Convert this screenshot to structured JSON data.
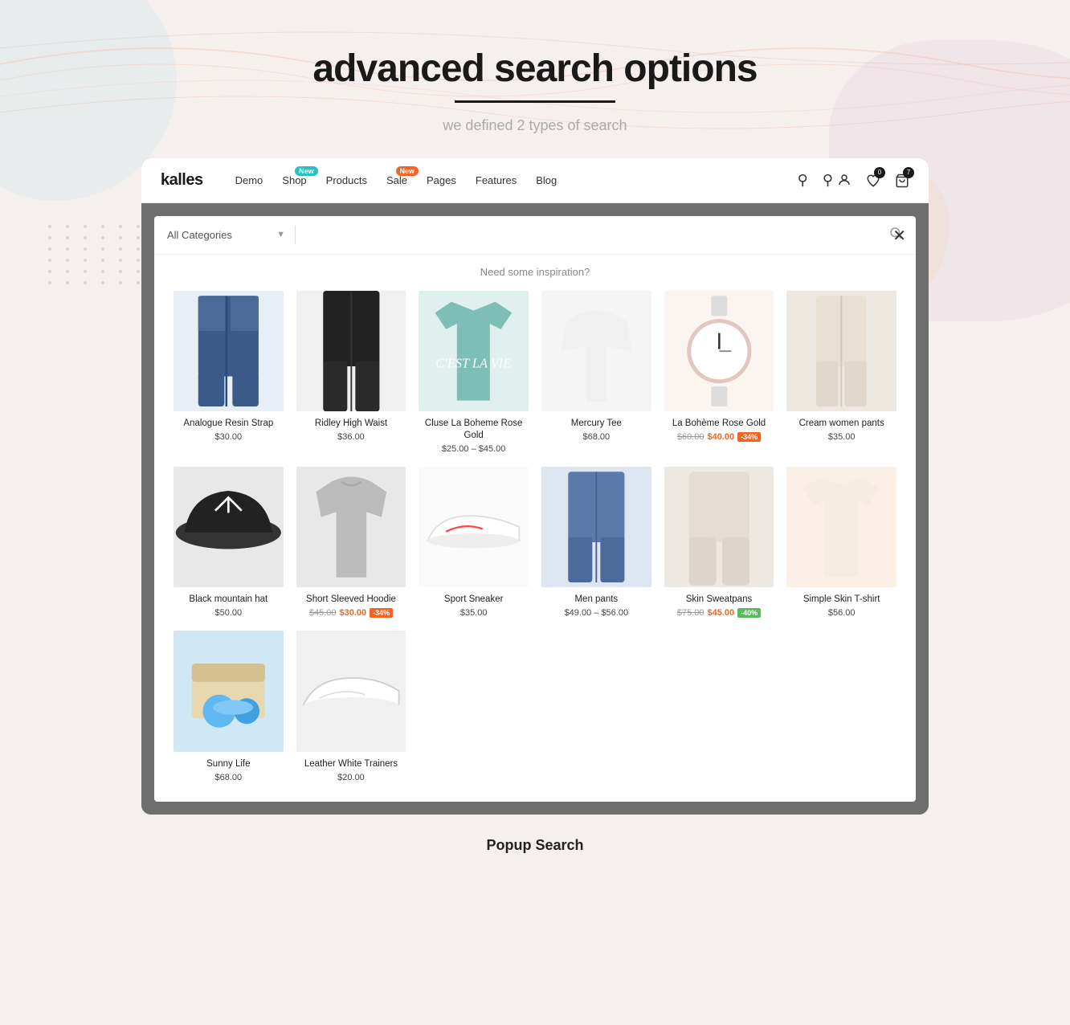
{
  "page": {
    "title": "advanced search  options",
    "underline": true,
    "subtitle": "we defined 2 types of search",
    "footer_label": "Popup Search"
  },
  "navbar": {
    "logo": "kalles",
    "items": [
      {
        "label": "Demo",
        "badge": null
      },
      {
        "label": "Shop",
        "badge": {
          "text": "New",
          "color": "teal"
        }
      },
      {
        "label": "Products",
        "badge": null
      },
      {
        "label": "Sale",
        "badge": {
          "text": "New",
          "color": "orange"
        }
      },
      {
        "label": "Pages",
        "badge": null
      },
      {
        "label": "Features",
        "badge": null
      },
      {
        "label": "Blog",
        "badge": null
      }
    ],
    "icons": [
      {
        "name": "search",
        "badge": null
      },
      {
        "name": "user",
        "badge": null
      },
      {
        "name": "wishlist",
        "badge": "0"
      },
      {
        "name": "cart",
        "badge": "7"
      }
    ]
  },
  "search_modal": {
    "category_placeholder": "All Categories",
    "search_placeholder": "",
    "inspiration_label": "Need some inspiration?",
    "close_label": "×"
  },
  "products": [
    {
      "name": "Analogue Resin Strap",
      "price_normal": "$30.00",
      "price_original": null,
      "price_sale": null,
      "discount": null,
      "img_class": "img-jeans",
      "emoji": "👖"
    },
    {
      "name": "Ridley High Waist",
      "price_normal": "$36.00",
      "price_original": null,
      "price_sale": null,
      "discount": null,
      "img_class": "img-black-pants",
      "emoji": "🩱"
    },
    {
      "name": "Cluse La Boheme Rose Gold",
      "price_normal": null,
      "price_original": "$25.00",
      "price_sale": "$45.00",
      "price_range": "$25.00 – $45.00",
      "discount": null,
      "img_class": "img-tee",
      "emoji": "👕"
    },
    {
      "name": "Mercury Tee",
      "price_normal": "$68.00",
      "price_original": null,
      "price_sale": null,
      "discount": null,
      "img_class": "img-white-top",
      "emoji": "👚"
    },
    {
      "name": "La Bohème Rose Gold",
      "price_normal": null,
      "price_original": "$60.00",
      "price_sale": "$40.00",
      "discount": "-34%",
      "discount_color": "orange",
      "img_class": "img-watch",
      "emoji": "⌚"
    },
    {
      "name": "Cream women pants",
      "price_normal": "$35.00",
      "price_original": null,
      "price_sale": null,
      "discount": null,
      "img_class": "img-cream-pants",
      "emoji": "👗"
    },
    {
      "name": "Black mountain hat",
      "price_normal": "$50.00",
      "price_original": null,
      "price_sale": null,
      "discount": null,
      "img_class": "img-hat",
      "emoji": "🧢"
    },
    {
      "name": "Short Sleeved Hoodie",
      "price_normal": null,
      "price_original": "$45.00",
      "price_sale": "$30.00",
      "discount": "-34%",
      "discount_color": "orange",
      "img_class": "img-hoodie",
      "emoji": "🧥"
    },
    {
      "name": "Sport Sneaker",
      "price_normal": "$35.00",
      "price_original": null,
      "price_sale": null,
      "discount": null,
      "img_class": "img-sneaker",
      "emoji": "👟"
    },
    {
      "name": "Men pants",
      "price_normal": null,
      "price_original": "$49.00",
      "price_sale": "$56.00",
      "price_range": "$49.00 – $56.00",
      "discount": null,
      "img_class": "img-men-pants",
      "emoji": "👖"
    },
    {
      "name": "Skin Sweatpans",
      "price_normal": null,
      "price_original": "$75.00",
      "price_sale": "$45.00",
      "discount": "-40%",
      "discount_color": "green",
      "img_class": "img-sweatpants",
      "emoji": "🩲"
    },
    {
      "name": "Simple Skin T-shirt",
      "price_normal": "$56.00",
      "price_original": null,
      "price_sale": null,
      "discount": null,
      "img_class": "img-tshirt",
      "emoji": "👕"
    },
    {
      "name": "Sunny Life",
      "price_normal": "$68.00",
      "price_original": null,
      "price_sale": null,
      "discount": null,
      "img_class": "img-sunny",
      "emoji": "🏄"
    },
    {
      "name": "Leather White Trainers",
      "price_normal": "$20.00",
      "price_original": null,
      "price_sale": null,
      "discount": null,
      "img_class": "img-trainers",
      "emoji": "👟"
    }
  ]
}
